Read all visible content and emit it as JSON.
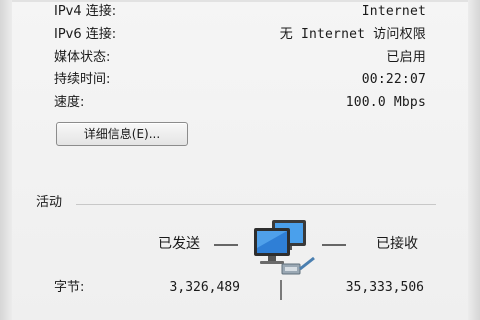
{
  "connection": {
    "rows": [
      {
        "label": "IPv4 连接:",
        "value": "Internet"
      },
      {
        "label": "IPv6 连接:",
        "value": "无 Internet 访问权限"
      },
      {
        "label": "媒体状态:",
        "value": "已启用"
      },
      {
        "label": "持续时间:",
        "value": "00:22:07"
      },
      {
        "label": "速度:",
        "value": "100.0 Mbps"
      }
    ],
    "details_button": "详细信息(E)..."
  },
  "activity": {
    "title": "活动",
    "sent_label": "已发送",
    "received_label": "已接收",
    "bytes_label": "字节:",
    "bytes_sent": "3,326,489",
    "bytes_received": "35,333,506"
  },
  "icons": {
    "network": "network-computers-icon"
  },
  "colors": {
    "background": "#f2f2f2",
    "button_border": "#8c8c8c",
    "divider": "#c8c8c8",
    "monitor_blue": "#2f7fd6"
  }
}
